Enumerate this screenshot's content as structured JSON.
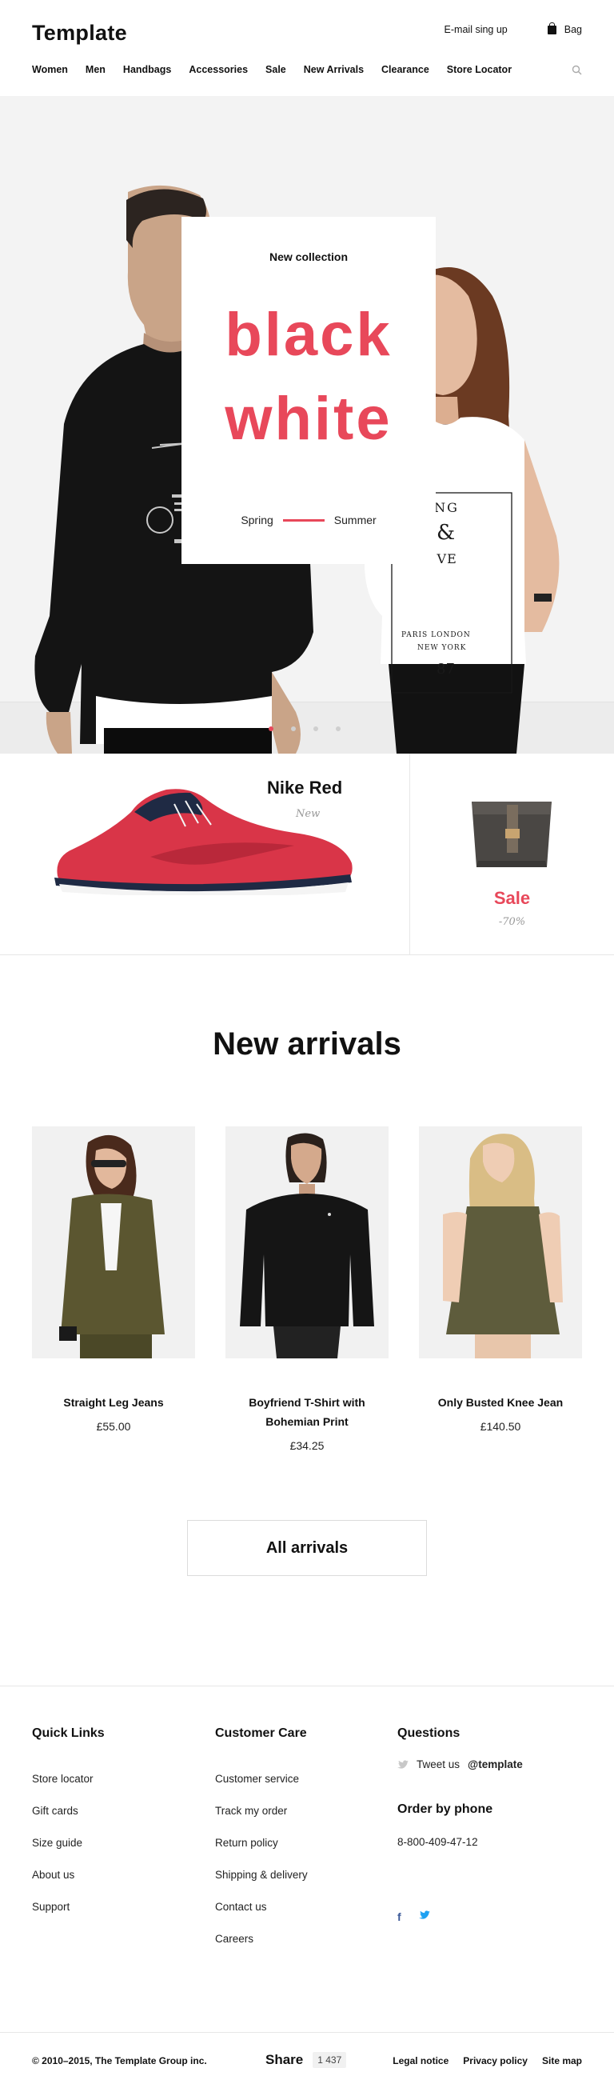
{
  "header": {
    "logo": "Template",
    "email_signup": "E-mail sing up",
    "bag": "Bag",
    "nav": [
      "Women",
      "Men",
      "Handbags",
      "Accessories",
      "Sale",
      "New Arrivals",
      "Clearance",
      "Store Locator"
    ]
  },
  "hero": {
    "eyebrow": "New collection",
    "line1": "black",
    "line2": "white",
    "season_from": "Spring",
    "season_to": "Summer",
    "slides": 4,
    "active_slide": 1
  },
  "feature": {
    "shoe_title": "Nike Red",
    "shoe_sub": "New",
    "sale_label": "Sale",
    "sale_pct": "-70%"
  },
  "arrivals": {
    "title": "New arrivals",
    "products": [
      {
        "name": "Straight Leg Jeans",
        "price": "£55.00"
      },
      {
        "name": "Boyfriend T-Shirt with Bohemian Print",
        "price": "£34.25"
      },
      {
        "name": "Only Busted Knee Jean",
        "price": "£140.50"
      }
    ],
    "all_button": "All arrivals"
  },
  "footer": {
    "quick_links": {
      "title": "Quick Links",
      "items": [
        "Store locator",
        "Gift cards",
        "Size guide",
        "About us",
        "Support"
      ]
    },
    "customer_care": {
      "title": "Customer Care",
      "items": [
        "Customer service",
        "Track my order",
        "Return policy",
        "Shipping & delivery",
        "Contact us",
        "Careers"
      ]
    },
    "questions": {
      "title": "Questions",
      "tweet_text": "Tweet us",
      "tweet_handle": "@template",
      "phone_title": "Order by phone",
      "phone": "8-800-409-47-12"
    },
    "copyright": "© 2010–2015, The Template Group inc.",
    "share_label": "Share",
    "share_count": "1 437",
    "legal": [
      "Legal notice",
      "Privacy policy",
      "Site map"
    ]
  },
  "colors": {
    "accent": "#e8485a",
    "facebook": "#3b5998",
    "twitter": "#1da1f2"
  },
  "icons": [
    "bag-icon",
    "search-icon",
    "twitter-icon",
    "facebook-icon"
  ]
}
